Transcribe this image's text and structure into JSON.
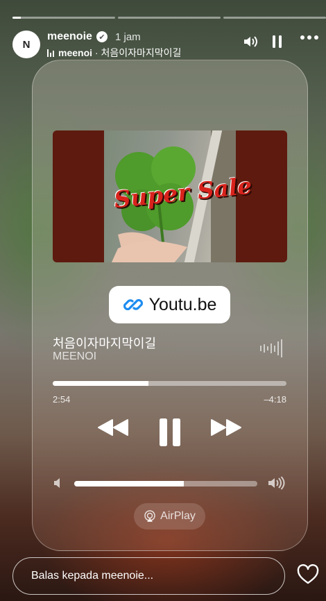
{
  "story": {
    "segments": [
      {
        "progress": 0.08
      },
      {
        "progress": 0
      },
      {
        "progress": 0
      }
    ]
  },
  "header": {
    "avatar_text": "N",
    "username": "meenoie",
    "verified_icon": "verified-badge-icon",
    "time": "1 jam",
    "music_artist": "meenoi",
    "music_separator": " · ",
    "music_title": "처음이자마지막이길",
    "icons": [
      "volume-icon",
      "pause-icon",
      "more-icon"
    ]
  },
  "player": {
    "artwork_text": "Super Sale",
    "link_label": "Youtu.be",
    "song_title": "처음이자마지막이길",
    "artist": "MEENOI",
    "progress": 0.41,
    "elapsed": "2:54",
    "remaining": "–4:18",
    "volume": 0.6,
    "airplay_label": "AirPlay"
  },
  "footer": {
    "reply_placeholder": "Balas kepada meenoie..."
  },
  "colors": {
    "art_background": "#5e1a0e",
    "sale_text": "#d8231c",
    "link_icon": "#1d8cf0"
  }
}
